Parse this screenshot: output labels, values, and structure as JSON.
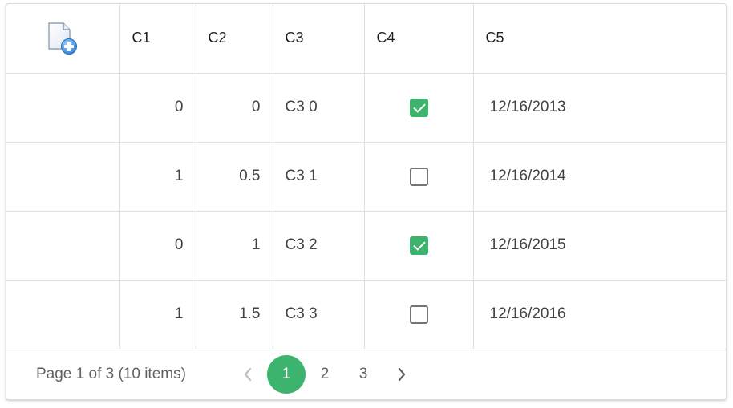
{
  "grid": {
    "columns": [
      {
        "label": "C1"
      },
      {
        "label": "C2"
      },
      {
        "label": "C3"
      },
      {
        "label": "C4"
      },
      {
        "label": "C5"
      }
    ],
    "rows": [
      {
        "c1": "0",
        "c2": "0",
        "c3": "C3 0",
        "c4": true,
        "c5": "12/16/2013"
      },
      {
        "c1": "1",
        "c2": "0.5",
        "c3": "C3 1",
        "c4": false,
        "c5": "12/16/2014"
      },
      {
        "c1": "0",
        "c2": "1",
        "c3": "C3 2",
        "c4": true,
        "c5": "12/16/2015"
      },
      {
        "c1": "1",
        "c2": "1.5",
        "c3": "C3 3",
        "c4": false,
        "c5": "12/16/2016"
      }
    ]
  },
  "icons": {
    "add_row": "add-document-icon",
    "prev": "chevron-left-icon",
    "next": "chevron-right-icon"
  },
  "pager": {
    "info": "Page 1 of 3 (10 items)",
    "pages": [
      "1",
      "2",
      "3"
    ],
    "current_page": "1"
  },
  "colors": {
    "accent": "#3cb46e",
    "border": "#e0e0e0",
    "text": "#424242"
  }
}
